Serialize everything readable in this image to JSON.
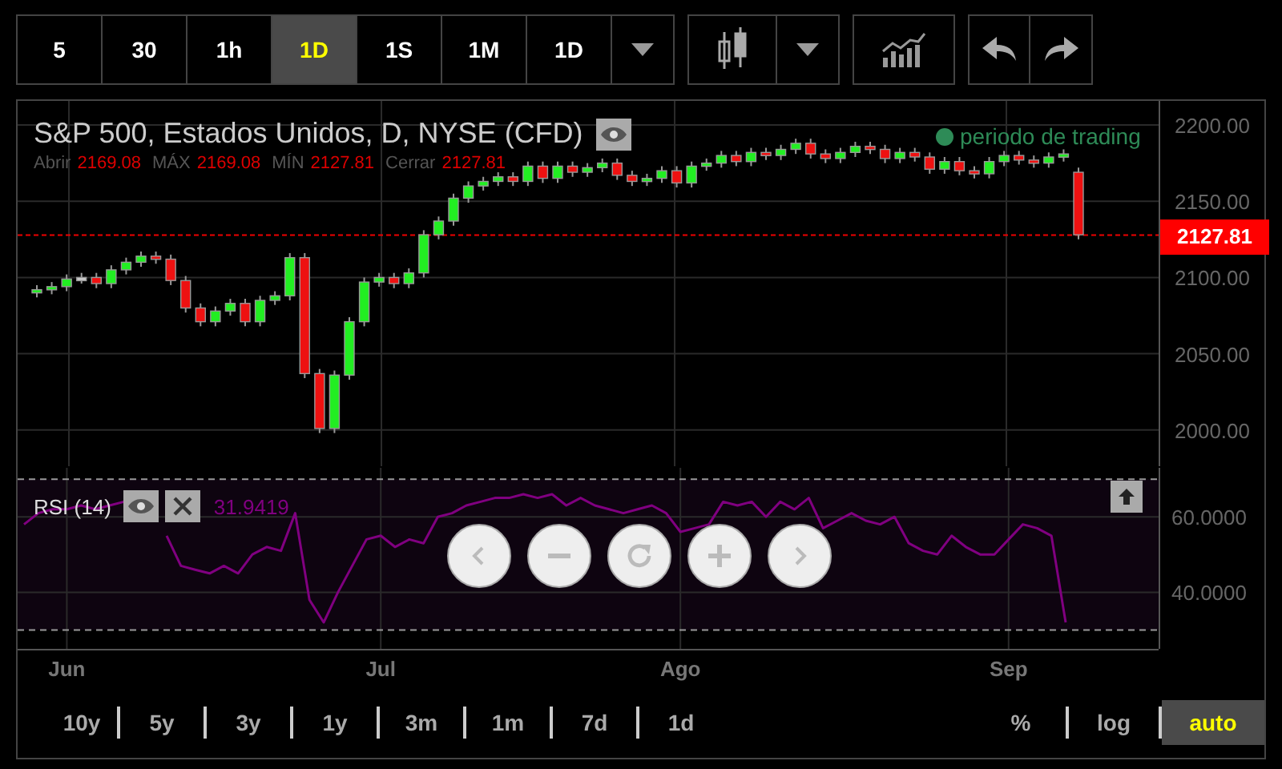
{
  "toolbar": {
    "intervals": [
      {
        "label": "5",
        "selected": false
      },
      {
        "label": "30",
        "selected": false
      },
      {
        "label": "1h",
        "selected": false
      },
      {
        "label": "1D",
        "selected": true
      },
      {
        "label": "1S",
        "selected": false
      },
      {
        "label": "1M",
        "selected": false
      },
      {
        "label": "1D",
        "selected": false
      }
    ]
  },
  "price_chart": {
    "title": "S&P 500, Estados Unidos, D, NYSE (CFD)",
    "ohlc": [
      {
        "label": "Abrir",
        "value": "2169.08"
      },
      {
        "label": "MÁX",
        "value": "2169.08"
      },
      {
        "label": "MÍN",
        "value": "2127.81"
      },
      {
        "label": "Cerrar",
        "value": "2127.81"
      }
    ],
    "legend": "periodo de trading",
    "current_price": "2127.81",
    "chart_data": {
      "type": "candlestick",
      "grid": true,
      "ref_lines": [
        {
          "axis": "y",
          "value": 2127.81
        }
      ],
      "categories": [
        null,
        null,
        null,
        null,
        null,
        null,
        null,
        null,
        null,
        null,
        null,
        null,
        null,
        null,
        null,
        null,
        null,
        null,
        null,
        null,
        null,
        null,
        null,
        null,
        null,
        null,
        null,
        null,
        null,
        null,
        null,
        null,
        null,
        null,
        null,
        null,
        null,
        null,
        null,
        null,
        null,
        null,
        null,
        null,
        null,
        null,
        null,
        null,
        null,
        null,
        null,
        null,
        null,
        null,
        null,
        null,
        null,
        null,
        null,
        null,
        null,
        null,
        null,
        null,
        null,
        null,
        null,
        null,
        null,
        null,
        null
      ],
      "ylim": [
        1976.26,
        2215.76
      ],
      "yticks": [
        {
          "value": 2200,
          "label": "2200.00"
        },
        {
          "value": 2150,
          "label": "2150.00"
        },
        {
          "value": 2100,
          "label": "2100.00"
        },
        {
          "value": 2050,
          "label": "2050.00"
        },
        {
          "value": 2000,
          "label": "2000.00"
        }
      ],
      "ohlc": [
        [
          2090,
          2095,
          2087,
          2092
        ],
        [
          2092,
          2097,
          2089,
          2094
        ],
        [
          2094,
          2102,
          2091,
          2099
        ],
        [
          2099,
          2103,
          2096,
          2100
        ],
        [
          2100,
          2103,
          2093,
          2096
        ],
        [
          2096,
          2108,
          2093,
          2105
        ],
        [
          2105,
          2113,
          2102,
          2110
        ],
        [
          2110,
          2117,
          2107,
          2114
        ],
        [
          2114,
          2117,
          2109,
          2112
        ],
        [
          2112,
          2115,
          2095,
          2098
        ],
        [
          2098,
          2101,
          2077,
          2080
        ],
        [
          2080,
          2083,
          2068,
          2071
        ],
        [
          2071,
          2081,
          2068,
          2078
        ],
        [
          2078,
          2086,
          2075,
          2083
        ],
        [
          2083,
          2086,
          2068,
          2071
        ],
        [
          2071,
          2088,
          2068,
          2085
        ],
        [
          2085,
          2091,
          2082,
          2088
        ],
        [
          2088,
          2116,
          2085,
          2113
        ],
        [
          2113,
          2116,
          2034,
          2037
        ],
        [
          2037,
          2040,
          1998,
          2001
        ],
        [
          2001,
          2039,
          1998,
          2036
        ],
        [
          2036,
          2074,
          2033,
          2071
        ],
        [
          2071,
          2100,
          2068,
          2097
        ],
        [
          2097,
          2103,
          2094,
          2100
        ],
        [
          2100,
          2103,
          2093,
          2096
        ],
        [
          2096,
          2106,
          2093,
          2103
        ],
        [
          2103,
          2131,
          2100,
          2128
        ],
        [
          2128,
          2140,
          2125,
          2137
        ],
        [
          2137,
          2155,
          2134,
          2152
        ],
        [
          2152,
          2163,
          2149,
          2160
        ],
        [
          2160,
          2166,
          2157,
          2163
        ],
        [
          2163,
          2169,
          2160,
          2166
        ],
        [
          2166,
          2169,
          2160,
          2163
        ],
        [
          2163,
          2176,
          2160,
          2173
        ],
        [
          2173,
          2176,
          2162,
          2165
        ],
        [
          2165,
          2176,
          2162,
          2173
        ],
        [
          2173,
          2176,
          2166,
          2169
        ],
        [
          2169,
          2175,
          2166,
          2172
        ],
        [
          2172,
          2178,
          2169,
          2175
        ],
        [
          2175,
          2178,
          2164,
          2167
        ],
        [
          2167,
          2170,
          2160,
          2163
        ],
        [
          2163,
          2168,
          2160,
          2165
        ],
        [
          2165,
          2173,
          2162,
          2170
        ],
        [
          2170,
          2173,
          2159,
          2162
        ],
        [
          2162,
          2176,
          2159,
          2173
        ],
        [
          2173,
          2178,
          2170,
          2175
        ],
        [
          2175,
          2183,
          2172,
          2180
        ],
        [
          2180,
          2183,
          2173,
          2176
        ],
        [
          2176,
          2185,
          2173,
          2182
        ],
        [
          2182,
          2185,
          2177,
          2180
        ],
        [
          2180,
          2187,
          2177,
          2184
        ],
        [
          2184,
          2191,
          2181,
          2188
        ],
        [
          2188,
          2191,
          2178,
          2181
        ],
        [
          2181,
          2184,
          2175,
          2178
        ],
        [
          2178,
          2185,
          2175,
          2182
        ],
        [
          2182,
          2189,
          2179,
          2186
        ],
        [
          2186,
          2189,
          2181,
          2184
        ],
        [
          2184,
          2187,
          2175,
          2178
        ],
        [
          2178,
          2185,
          2175,
          2182
        ],
        [
          2182,
          2185,
          2176,
          2179
        ],
        [
          2179,
          2182,
          2168,
          2171
        ],
        [
          2171,
          2179,
          2168,
          2176
        ],
        [
          2176,
          2179,
          2167,
          2170
        ],
        [
          2170,
          2173,
          2165,
          2168
        ],
        [
          2168,
          2179,
          2165,
          2176
        ],
        [
          2176,
          2183,
          2173,
          2180
        ],
        [
          2180,
          2183,
          2174,
          2177
        ],
        [
          2177,
          2180,
          2172,
          2175
        ],
        [
          2175,
          2182,
          2172,
          2179
        ],
        [
          2179,
          2184,
          2176,
          2181
        ],
        [
          2169,
          2172,
          2125,
          2128
        ]
      ]
    }
  },
  "rsi": {
    "value": "31.9419",
    "chart_data": {
      "type": "line",
      "categories": [
        null,
        null,
        null,
        "Jun",
        null,
        null,
        null,
        null,
        null,
        null,
        null,
        null,
        null,
        null,
        null,
        null,
        null,
        null,
        null,
        null,
        null,
        null,
        null,
        null,
        null,
        "Jul",
        null,
        null,
        null,
        null,
        null,
        null,
        null,
        null,
        null,
        null,
        null,
        null,
        null,
        null,
        null,
        null,
        null,
        null,
        null,
        null,
        "Ago",
        null,
        null,
        null,
        null,
        null,
        null,
        null,
        null,
        null,
        null,
        null,
        null,
        null,
        null,
        null,
        null,
        null,
        null,
        null,
        null,
        null,
        null,
        "Sep",
        null,
        null,
        null,
        null
      ],
      "series": [
        {
          "name": "RSI (14)",
          "color": "#800080",
          "values": [
            58,
            61,
            62,
            62,
            63,
            62,
            63,
            64,
            null,
            null,
            55,
            47,
            46,
            45,
            47,
            45,
            50,
            52,
            51,
            61,
            38,
            32,
            40,
            47,
            54,
            55,
            52,
            54,
            53,
            60,
            61,
            63,
            64,
            65,
            65,
            66,
            65,
            66,
            63,
            65,
            63,
            62,
            61,
            62,
            63,
            61,
            56,
            57,
            58,
            64,
            63,
            64,
            60,
            64,
            62,
            65,
            57,
            59,
            61,
            59,
            58,
            60,
            53,
            51,
            50,
            55,
            52,
            50,
            50,
            54,
            58,
            57,
            55,
            32
          ]
        }
      ],
      "ylim": [
        25,
        73
      ],
      "yticks": [
        {
          "value": 60,
          "label": "60.0000"
        },
        {
          "value": 40,
          "label": "40.0000"
        }
      ],
      "grid": true,
      "ref_lines": [
        {
          "axis": "y",
          "value": 70
        },
        {
          "axis": "y",
          "value": 30
        }
      ]
    }
  },
  "ranges": [
    {
      "label": "10y"
    },
    {
      "label": "5y"
    },
    {
      "label": "3y"
    },
    {
      "label": "1y"
    },
    {
      "label": "3m"
    },
    {
      "label": "1m"
    },
    {
      "label": "7d"
    },
    {
      "label": "1d"
    }
  ],
  "scale_options": [
    {
      "label": "%",
      "selected": false
    },
    {
      "label": "log",
      "selected": false
    },
    {
      "label": "auto",
      "selected": true
    }
  ]
}
